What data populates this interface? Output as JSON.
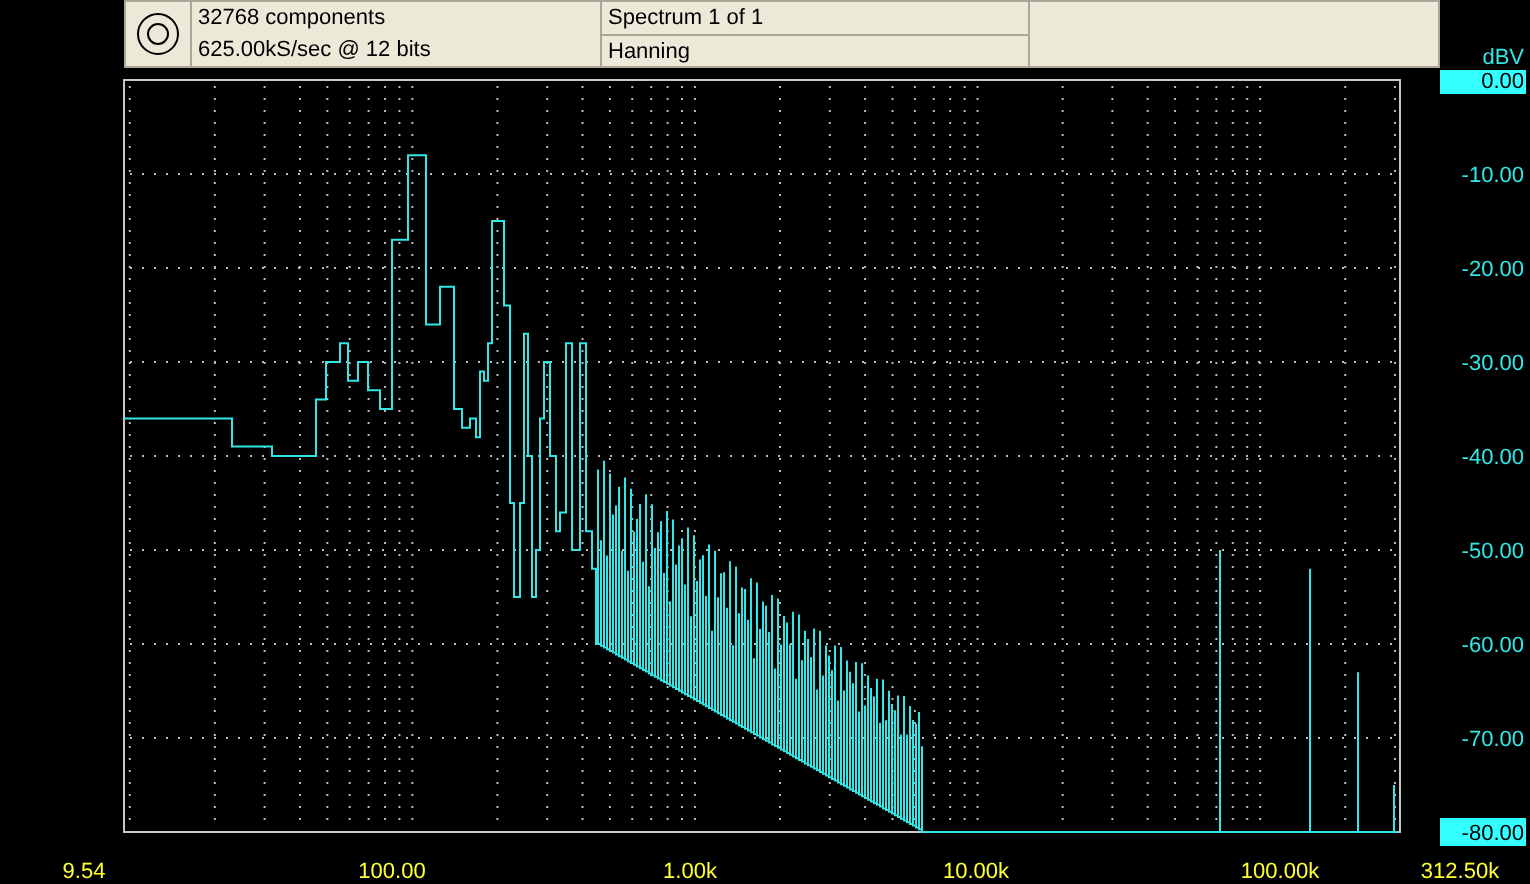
{
  "info_panel": {
    "components": "32768 components",
    "sample_rate": "625.00kS/sec @ 12 bits",
    "spectrum": "Spectrum 1 of 1",
    "window_function": "Hanning"
  },
  "y_axis": {
    "unit": "dBV",
    "ticks": [
      {
        "label": "0.00",
        "highlighted": true
      },
      {
        "label": "-10.00",
        "highlighted": false
      },
      {
        "label": "-20.00",
        "highlighted": false
      },
      {
        "label": "-30.00",
        "highlighted": false
      },
      {
        "label": "-40.00",
        "highlighted": false
      },
      {
        "label": "-50.00",
        "highlighted": false
      },
      {
        "label": "-60.00",
        "highlighted": false
      },
      {
        "label": "-70.00",
        "highlighted": false
      },
      {
        "label": "-80.00",
        "highlighted": true
      }
    ]
  },
  "x_axis": {
    "ticks": [
      "9.54",
      "100.00",
      "1.00k",
      "10.00k",
      "100.00k",
      "312.50k"
    ]
  }
}
